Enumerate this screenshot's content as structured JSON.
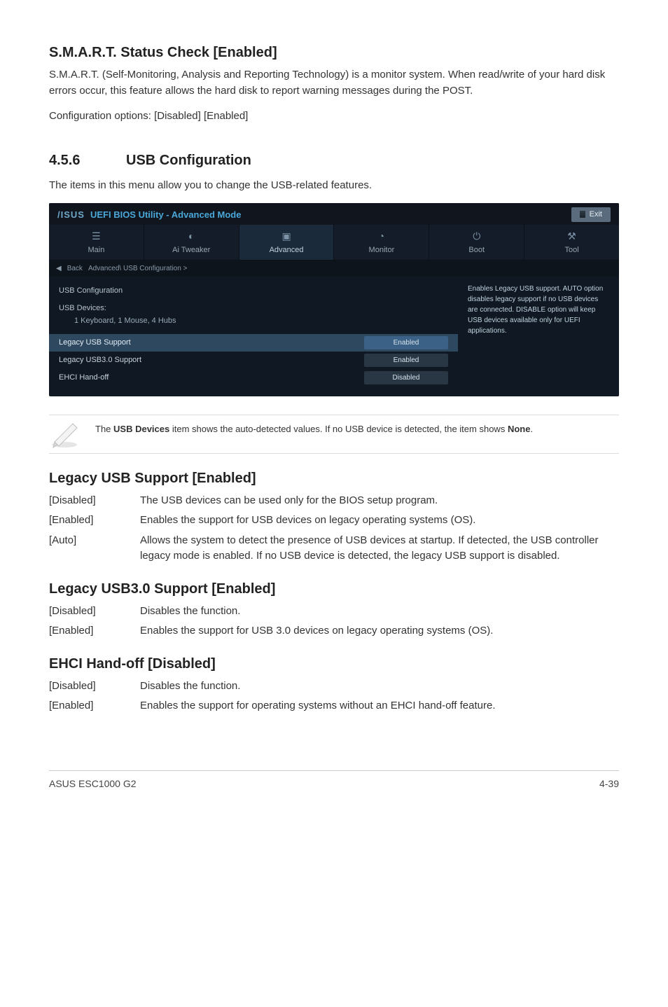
{
  "sections": {
    "smart": {
      "heading": "S.M.A.R.T. Status Check [Enabled]",
      "para": "S.M.A.R.T. (Self-Monitoring, Analysis and Reporting Technology) is a monitor system. When read/write of your hard disk errors occur, this feature allows the hard disk to report warning messages during the POST.",
      "config": "Configuration options: [Disabled] [Enabled]"
    },
    "usbconf": {
      "number": "4.5.6",
      "title": "USB Configuration",
      "intro": "The items in this menu allow you to change the USB-related features."
    }
  },
  "bios": {
    "logo": "/ISUS",
    "title": "UEFI BIOS Utility - Advanced Mode",
    "exit": "Exit",
    "tabs": [
      "Main",
      "Ai  Tweaker",
      "Advanced",
      "Monitor",
      "Boot",
      "Tool"
    ],
    "breadcrumb_back": "Back",
    "breadcrumb_path": "Advanced\\ USB Configuration  >",
    "left": {
      "group_head": "USB Configuration",
      "group_sub1": "USB Devices:",
      "group_sub2": "1 Keyboard, 1 Mouse, 4 Hubs",
      "row1_label": "Legacy USB Support",
      "row1_value": "Enabled",
      "row2_label": "Legacy USB3.0 Support",
      "row2_value": "Enabled",
      "row3_label": "EHCI Hand-off",
      "row3_value": "Disabled"
    },
    "right_help": "Enables Legacy USB support. AUTO option disables legacy support if no USB devices are connected. DISABLE option will keep USB devices available only for UEFI applications."
  },
  "note": {
    "prefix": "The ",
    "bold": "USB Devices",
    "middle": " item shows the auto-detected values. If no USB device is detected, the item shows ",
    "bold2": "None",
    "suffix": "."
  },
  "legacy_usb": {
    "heading": "Legacy USB Support [Enabled]",
    "rows": [
      {
        "term": "[Disabled]",
        "def": "The USB devices can be used only for the BIOS setup program."
      },
      {
        "term": "[Enabled]",
        "def": "Enables the support for USB devices on legacy operating systems (OS)."
      },
      {
        "term": "[Auto]",
        "def": "Allows the system to detect the presence of USB devices at startup. If detected, the USB controller legacy mode is enabled. If no USB device is detected, the legacy USB support is disabled."
      }
    ]
  },
  "legacy_usb30": {
    "heading": "Legacy USB3.0 Support [Enabled]",
    "rows": [
      {
        "term": "[Disabled]",
        "def": "Disables the function."
      },
      {
        "term": "[Enabled]",
        "def": "Enables the support for USB 3.0 devices on legacy operating systems (OS)."
      }
    ]
  },
  "ehci": {
    "heading": "EHCI Hand-off [Disabled]",
    "rows": [
      {
        "term": "[Disabled]",
        "def": "Disables the function."
      },
      {
        "term": "[Enabled]",
        "def": "Enables the support for operating systems without an EHCI hand-off feature."
      }
    ]
  },
  "footer": {
    "left": "ASUS ESC1000 G2",
    "right": "4-39"
  }
}
